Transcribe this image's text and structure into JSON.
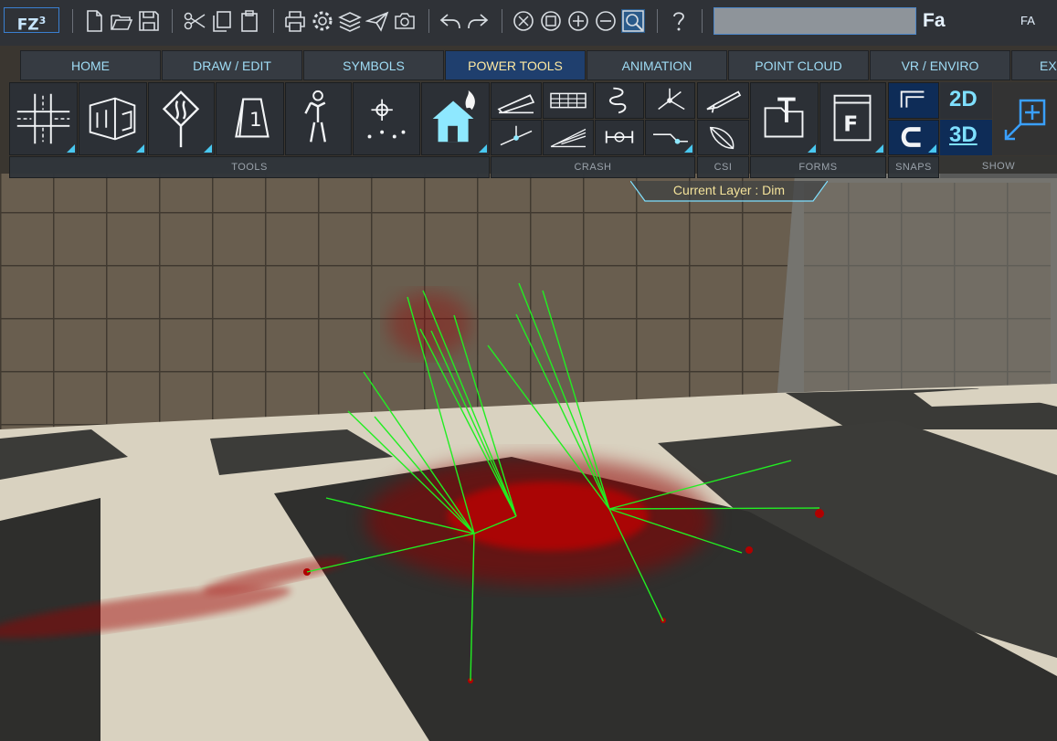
{
  "app": {
    "logo_text": "FZ",
    "logo_superscript": "3"
  },
  "toolbar": {
    "icons": [
      "new-file-icon",
      "open-folder-icon",
      "save-icon",
      "cut-icon",
      "copy-icon",
      "paste-icon",
      "print-icon",
      "settings-icon",
      "layers-icon",
      "send-icon",
      "camera-icon",
      "undo-icon",
      "redo-icon",
      "zoom-extents-icon",
      "zoom-window-icon",
      "zoom-in-icon",
      "zoom-out-icon",
      "zoom-box-icon",
      "help-icon"
    ],
    "search_value": "",
    "fa_label": "Fa",
    "fa_right": "FA"
  },
  "tabs": [
    {
      "label": "HOME",
      "active": false
    },
    {
      "label": "DRAW / EDIT",
      "active": false
    },
    {
      "label": "SYMBOLS",
      "active": false
    },
    {
      "label": "POWER TOOLS",
      "active": true
    },
    {
      "label": "ANIMATION",
      "active": false
    },
    {
      "label": "POINT CLOUD",
      "active": false
    },
    {
      "label": "VR / ENVIRO",
      "active": false
    },
    {
      "label": "EXI",
      "active": false
    }
  ],
  "groups": {
    "tools": "TOOLS",
    "crash": "CRASH",
    "csi": "CSI",
    "forms": "FORMS",
    "snaps": "SNAPS",
    "show": "SHOW"
  },
  "ribbon": {
    "tools_icons": [
      "intersection-icon",
      "building-icon",
      "road-sign-icon",
      "evidence-marker-icon",
      "person-icon",
      "target-point-icon",
      "house-fire-icon"
    ],
    "crash_icons": [
      "ramp-icon",
      "grid-table-icon",
      "skid-path-icon",
      "node-branch-icon",
      "drop-point-icon",
      "slope-icon",
      "vehicle-axle-icon",
      "line-point-icon"
    ],
    "csi_icons": [
      "blood-spatter-trajectory-icon",
      "leaf-stain-icon"
    ],
    "forms_icons": [
      "text-form-icon",
      "form-template-icon"
    ],
    "snaps_icons": [
      "snap-corner-icon",
      "snap-magnet-icon"
    ],
    "mode_2d": "2D",
    "mode_3d": "3D"
  },
  "status": {
    "current_layer": "Current Layer : Dim"
  },
  "colors": {
    "accent": "#49c8f0",
    "active_tab": "#1f3f6e",
    "trajectory": "#22ee22",
    "blood": "#b00000"
  }
}
